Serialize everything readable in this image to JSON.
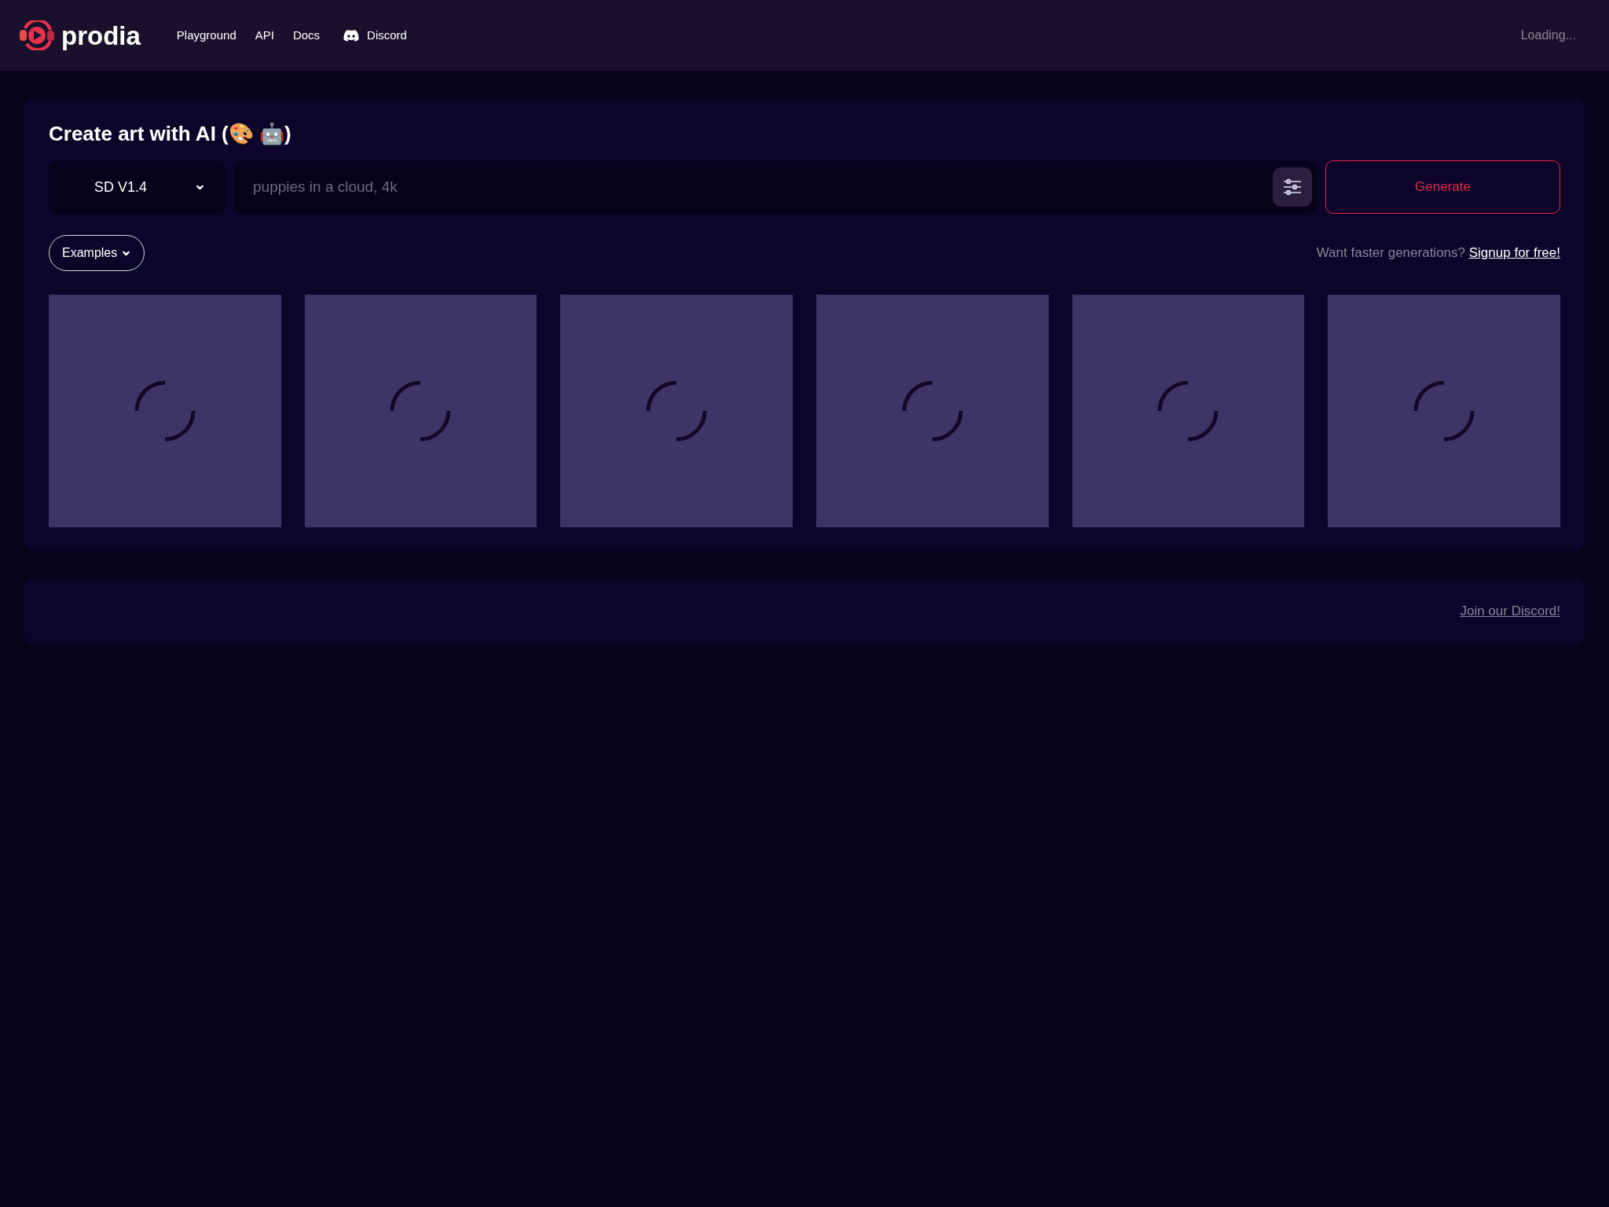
{
  "header": {
    "logo": "prodia",
    "nav": [
      {
        "label": "Playground",
        "kind": "link"
      },
      {
        "label": "API",
        "kind": "link"
      },
      {
        "label": "Docs",
        "kind": "link"
      },
      {
        "label": "Discord",
        "kind": "discord"
      }
    ],
    "status": "Loading..."
  },
  "generator": {
    "title": "Create art with AI (🎨 🤖)",
    "model": "SD V1.4",
    "prompt": {
      "placeholder": "puppies in a cloud, 4k"
    },
    "generate_button": "Generate",
    "examples_button": "Examples",
    "promo": {
      "text": "Want faster generations?",
      "link": "Signup for free!"
    },
    "tiles": [
      {
        "loading": true
      },
      {
        "loading": true
      },
      {
        "loading": true
      },
      {
        "loading": true
      },
      {
        "loading": true
      },
      {
        "loading": true
      }
    ]
  },
  "footer": {
    "link": "Join our Discord!"
  }
}
